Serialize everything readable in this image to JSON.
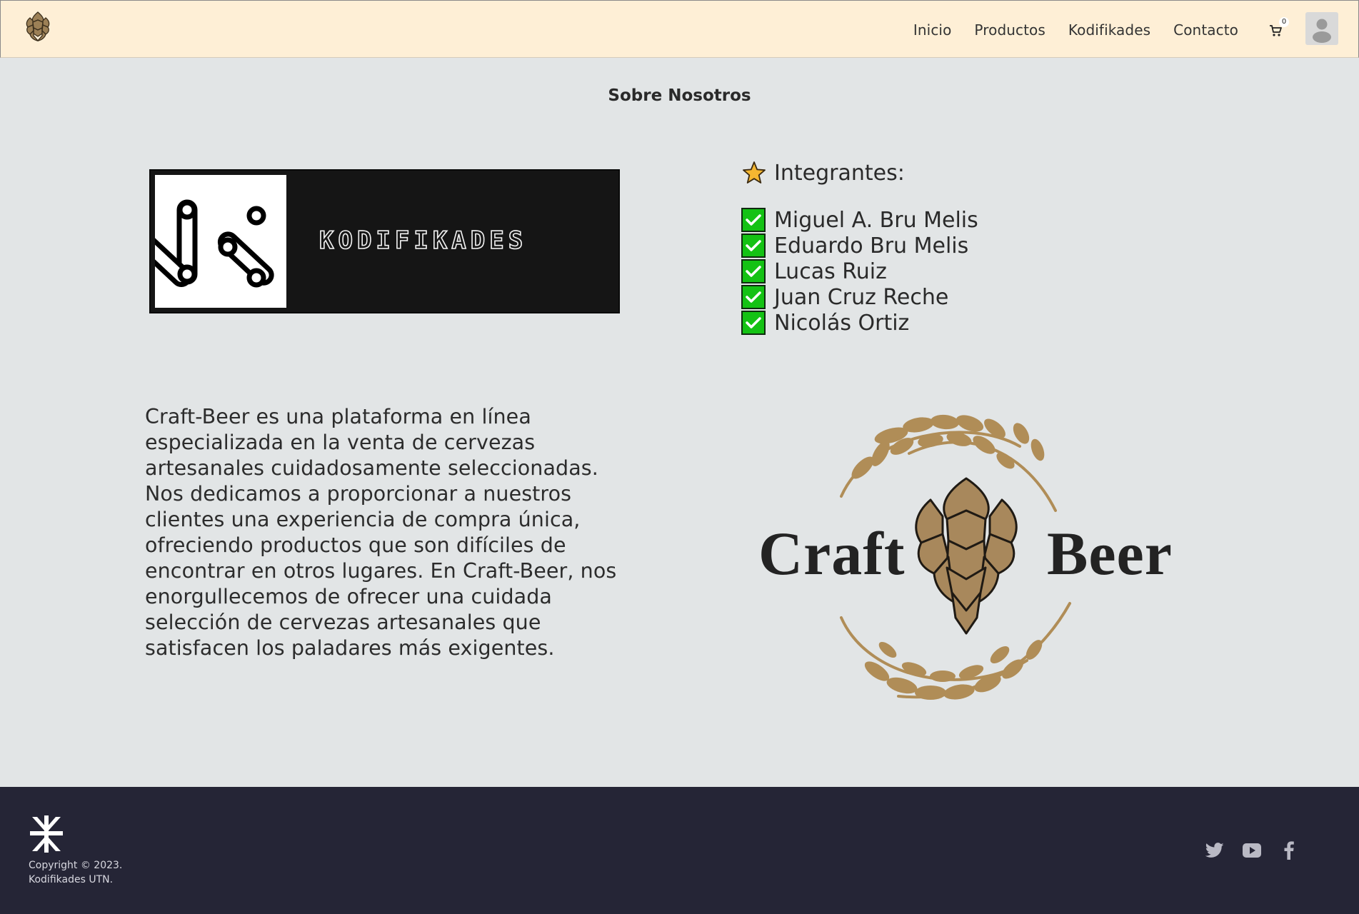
{
  "navbar": {
    "links": [
      "Inicio",
      "Productos",
      "Kodifikades",
      "Contacto"
    ],
    "cart_count": "0"
  },
  "page": {
    "title": "Sobre Nosotros"
  },
  "team_logo": {
    "wordmark": "KODIFIKADES"
  },
  "team": {
    "heading": "Integrantes:",
    "members": [
      "Miguel A. Bru Melis",
      "Eduardo Bru Melis",
      "Lucas Ruiz",
      "Juan Cruz Reche",
      "Nicolás Ortiz"
    ]
  },
  "about": {
    "lines": [
      "Craft-Beer es una plataforma en línea",
      "especializada en la venta de cervezas",
      "artesanales cuidadosamente seleccionadas.",
      "Nos dedicamos a proporcionar a nuestros",
      "clientes una experiencia de compra única,",
      "ofreciendo productos que son difíciles de",
      "encontrar en otros lugares. En Craft-Beer, nos",
      "enorgullecemos de ofrecer una cuidada",
      "selección de cervezas artesanales que",
      "satisfacen los paladares más exigentes."
    ]
  },
  "brand_logo": {
    "word_left": "Craft",
    "word_right": "Beer"
  },
  "footer": {
    "copyright_line1": "Copyright © 2023.",
    "copyright_line2": "Kodifikades UTN.",
    "socials": [
      "twitter-icon",
      "youtube-icon",
      "facebook-icon"
    ]
  },
  "colors": {
    "navbar_bg": "#feefd6",
    "page_bg": "#e2e5e6",
    "footer_bg": "#252536",
    "hop_gold": "#b08d57",
    "check_green": "#14c214",
    "star_yellow": "#f5b731"
  }
}
